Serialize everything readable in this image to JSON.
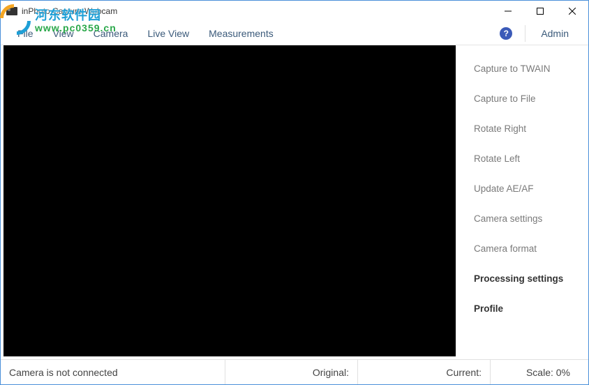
{
  "window": {
    "title": "inPhoto Capture Webcam"
  },
  "watermark": {
    "text1": "河东软件园",
    "text2": "www.pc0359.cn"
  },
  "menu": {
    "file": "File",
    "view": "View",
    "camera": "Camera",
    "liveview": "Live View",
    "measurements": "Measurements",
    "admin": "Admin"
  },
  "side": {
    "capture_twain": "Capture to TWAIN",
    "capture_file": "Capture to File",
    "rotate_right": "Rotate Right",
    "rotate_left": "Rotate Left",
    "update_aeaf": "Update AE/AF",
    "camera_settings": "Camera settings",
    "camera_format": "Camera format",
    "processing": "Processing settings",
    "profile": "Profile"
  },
  "status": {
    "message": "Camera is not connected",
    "original_label": "Original:",
    "current_label": "Current:",
    "scale_label": "Scale: 0%"
  }
}
